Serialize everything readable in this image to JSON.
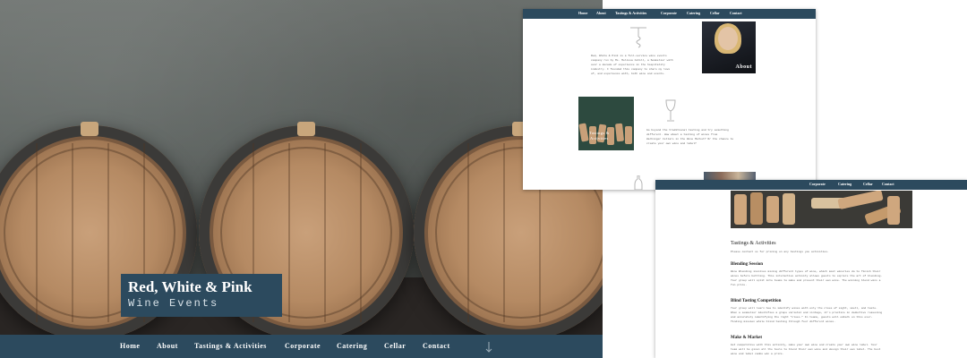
{
  "hero": {
    "title": "Red, White & Pink",
    "subtitle": "Wine Events",
    "nav": [
      "Home",
      "About",
      "Tastings & Activities",
      "Corporate",
      "Catering",
      "Cellar",
      "Contact"
    ],
    "scroll_icon": "arrow-down-icon"
  },
  "screenshot_about": {
    "nav": [
      "Home",
      "About",
      "Tastings & Activities",
      "Corporate",
      "Catering",
      "Cellar",
      "Contact"
    ],
    "about_label": "About",
    "tastings_label": "Tastings &\nActivities",
    "intro_text": "Red, White & Pink is a full-service wine events\ncompany run by Ms. Melissa Cohill, a Sommelier with\nover a decade of experience in the hospitality\nindustry. I founded this company to share my love\nof, and experience with, both wine and events.",
    "tastings_text": "Go beyond the traditional tasting and try something\ndifferent. How about a tasting of wines from\nHarbinger Cellars in the Wine Market? Or the chance to\ncreate your own wine and label?"
  },
  "screenshot_tastings": {
    "nav": [
      "Corporate",
      "Catering",
      "Cellar",
      "Contact"
    ],
    "page_title": "Tastings & Activities",
    "contact_line": "Please contact us for pricing on any tastings you activities.",
    "sections": [
      {
        "heading": "Blending Session",
        "body": "Wine Blending involves mixing different types of wine, which most wineries do to finish their\nwines before bottling. This interactive activity allows guests to explore the art of blending.\nYour group will split into teams to make and present their own wine. The winning blend wins a\nfun prize."
      },
      {
        "heading": "Blind Tasting Competition",
        "body": "Your group will learn how to identify wines with only the clues of sight, smell, and taste.\nWhen a sommelier identifies a grape varietal and vintage, it's practice in deductive reasoning\nand accurately identifying the right \"clues.\" In teams, guests will embark on this ever-\nfinding mission while blind tasting through four different wines."
      },
      {
        "heading": "Make & Market",
        "body": "Get competitive with this activity, make your own wine and create your own wine label. Your\nteam will be given all the tools to blend their own wine and design their own label. The best\nwine and label combo win a prize."
      }
    ]
  },
  "colors": {
    "nav_blue": "#2c4a5e",
    "nav_text": "#ffffff"
  }
}
